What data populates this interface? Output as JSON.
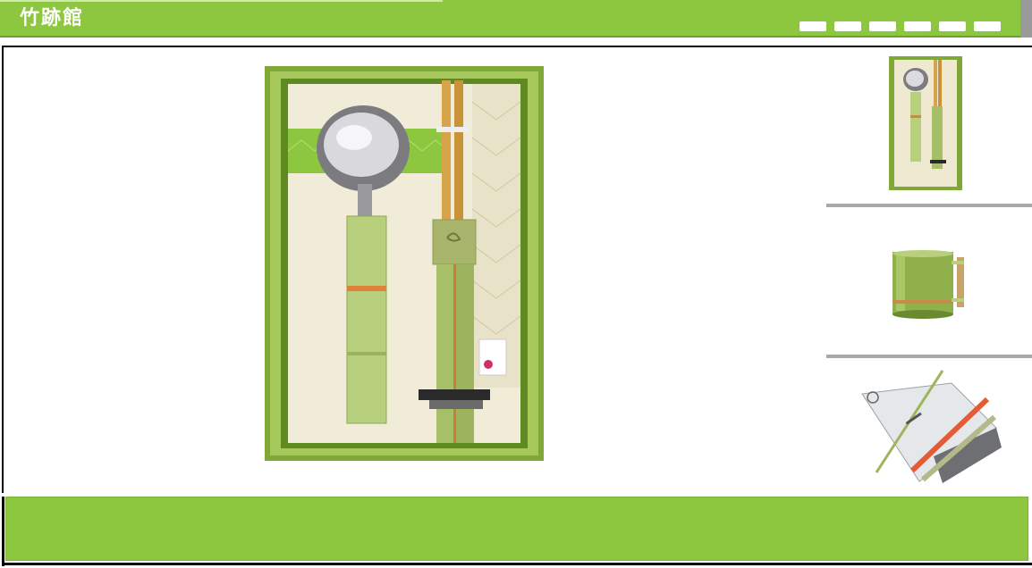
{
  "header": {
    "title": "竹跡館",
    "nav_buttons": [
      "",
      "",
      "",
      "",
      "",
      ""
    ]
  },
  "main": {
    "featured_product": "bamboo-spoon-chopsticks-gift-set"
  },
  "thumbnails": [
    {
      "name": "spoon-chopsticks-set"
    },
    {
      "name": "bamboo-mug"
    },
    {
      "name": "bamboo-utensil-kit"
    }
  ],
  "colors": {
    "brand_green": "#8dc63f",
    "separator_gray": "#a9a9a9"
  }
}
